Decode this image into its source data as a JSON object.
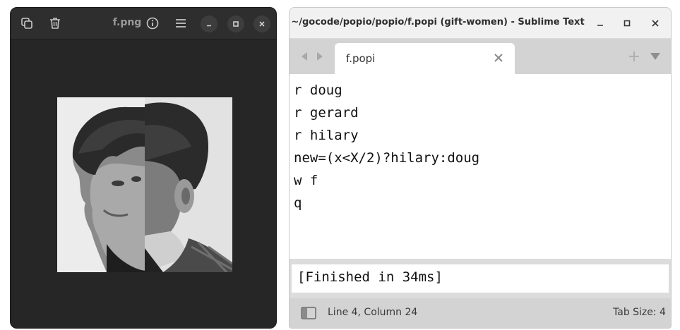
{
  "image_viewer": {
    "title": "f.png",
    "toolbar_icons": [
      "copy-icon",
      "trash-icon",
      "info-icon",
      "menu-icon"
    ],
    "window_controls": [
      "minimize-icon",
      "maximize-icon",
      "close-icon"
    ],
    "background_color": "#262626"
  },
  "sublime": {
    "title": "~/gocode/popio/popio/f.popi (gift-women) - Sublime Text",
    "tab": {
      "label": "f.popi"
    },
    "code_lines": [
      "r doug",
      "r gerard",
      "r hilary",
      "new=(x<X/2)?hilary:doug",
      "w f",
      "q"
    ],
    "output": "[Finished in 34ms]",
    "status": {
      "position": "Line 4, Column 24",
      "tab_size": "Tab Size: 4"
    }
  }
}
